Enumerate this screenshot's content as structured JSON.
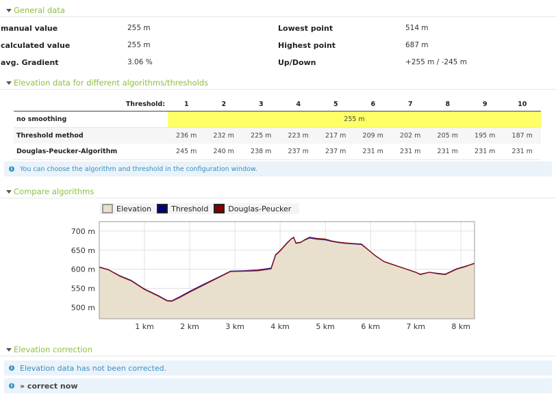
{
  "general": {
    "title": "General data",
    "rows": [
      {
        "label": "manual value",
        "value": "255 m",
        "label2": "Lowest point",
        "value2": "514 m"
      },
      {
        "label": "calculated value",
        "value": "255 m",
        "label2": "Highest point",
        "value2": "687 m"
      },
      {
        "label": "avg. Gradient",
        "value": "3.06 %",
        "label2": "Up/Down",
        "value2": "+255 m / -245 m"
      }
    ]
  },
  "elevation_table": {
    "title": "Elevation data for different algorithms/thresholds",
    "threshold_label": "Threshold:",
    "columns": [
      "1",
      "2",
      "3",
      "4",
      "5",
      "6",
      "7",
      "8",
      "9",
      "10"
    ],
    "no_smoothing": {
      "label": "no smoothing",
      "value": "255 m"
    },
    "threshold_method": {
      "label": "Threshold method",
      "values": [
        "236 m",
        "232 m",
        "225 m",
        "223 m",
        "217 m",
        "209 m",
        "202 m",
        "205 m",
        "195 m",
        "187 m"
      ]
    },
    "douglas_peucker": {
      "label": "Douglas-Peucker-Algorithm",
      "values": [
        "245 m",
        "240 m",
        "238 m",
        "237 m",
        "237 m",
        "231 m",
        "231 m",
        "231 m",
        "231 m",
        "231 m"
      ]
    },
    "info": "You can choose the algorithm and threshold in the configuration window."
  },
  "compare": {
    "title": "Compare algorithms",
    "legend": [
      {
        "name": "Elevation",
        "color": "#e8e0cc"
      },
      {
        "name": "Threshold",
        "color": "#000080"
      },
      {
        "name": "Douglas-Peucker",
        "color": "#800000"
      }
    ]
  },
  "chart_data": {
    "type": "area",
    "x_ticks": [
      "1 km",
      "2 km",
      "3 km",
      "4 km",
      "5 km",
      "6 km",
      "7 km",
      "8 km"
    ],
    "y_ticks": [
      "500 m",
      "550 m",
      "600 m",
      "650 m",
      "700 m"
    ],
    "xlim": [
      0,
      8.3
    ],
    "ylim": [
      470,
      725
    ],
    "grid": true,
    "legend_position": "top-left",
    "series": [
      {
        "name": "Elevation",
        "x": [
          0,
          0.2,
          0.45,
          0.7,
          1.0,
          1.3,
          1.5,
          1.6,
          1.75,
          2.0,
          2.3,
          2.7,
          2.9,
          3.2,
          3.5,
          3.8,
          3.9,
          4.0,
          4.15,
          4.25,
          4.3,
          4.35,
          4.45,
          4.55,
          4.65,
          4.8,
          5.0,
          5.15,
          5.3,
          5.45,
          5.8,
          6.0,
          6.1,
          6.3,
          6.5,
          6.8,
          7.0,
          7.1,
          7.3,
          7.5,
          7.65,
          7.9,
          8.1,
          8.3
        ],
        "y": [
          605,
          598,
          582,
          570,
          547,
          530,
          517,
          516,
          524,
          540,
          558,
          582,
          594,
          595,
          596,
          601,
          637,
          648,
          668,
          680,
          683,
          668,
          670,
          677,
          683,
          680,
          678,
          673,
          670,
          668,
          665,
          646,
          636,
          620,
          612,
          600,
          592,
          586,
          592,
          588,
          586,
          600,
          607,
          615
        ]
      },
      {
        "name": "Threshold",
        "x": [
          0,
          0.2,
          0.45,
          0.7,
          1.0,
          1.3,
          1.5,
          1.6,
          1.75,
          2.0,
          2.3,
          2.7,
          2.9,
          3.2,
          3.5,
          3.8,
          3.9,
          4.0,
          4.15,
          4.25,
          4.3,
          4.35,
          4.45,
          4.55,
          4.65,
          4.8,
          5.0,
          5.15,
          5.3,
          5.45,
          5.8,
          6.0,
          6.1,
          6.3,
          6.5,
          6.8,
          7.0,
          7.1,
          7.3,
          7.5,
          7.65,
          7.9,
          8.1,
          8.3
        ],
        "y": [
          605,
          599,
          583,
          571,
          548,
          531,
          518,
          517,
          526,
          542,
          560,
          583,
          595,
          596,
          598,
          603,
          638,
          649,
          669,
          680,
          683,
          669,
          671,
          677,
          682,
          679,
          677,
          673,
          670,
          668,
          665,
          646,
          636,
          620,
          612,
          600,
          592,
          587,
          592,
          589,
          587,
          601,
          608,
          615
        ]
      },
      {
        "name": "Douglas-Peucker",
        "x": [
          0,
          0.2,
          0.45,
          0.7,
          1.0,
          1.3,
          1.5,
          1.6,
          1.75,
          2.0,
          2.3,
          2.7,
          2.9,
          3.2,
          3.5,
          3.8,
          3.9,
          4.0,
          4.15,
          4.25,
          4.3,
          4.35,
          4.45,
          4.55,
          4.65,
          4.8,
          5.0,
          5.15,
          5.3,
          5.45,
          5.8,
          6.0,
          6.1,
          6.3,
          6.5,
          6.8,
          7.0,
          7.1,
          7.3,
          7.5,
          7.65,
          7.9,
          8.1,
          8.3
        ],
        "y": [
          606,
          599,
          582,
          570,
          547,
          530,
          517,
          516,
          524,
          540,
          558,
          582,
          594,
          595,
          596,
          601,
          637,
          648,
          668,
          680,
          684,
          668,
          670,
          678,
          684,
          681,
          679,
          674,
          671,
          669,
          666,
          646,
          636,
          620,
          612,
          600,
          592,
          586,
          592,
          588,
          586,
          600,
          607,
          616
        ]
      }
    ]
  },
  "correction": {
    "title": "Elevation correction",
    "info": "Elevation data has not been corrected.",
    "link": "» correct now"
  }
}
